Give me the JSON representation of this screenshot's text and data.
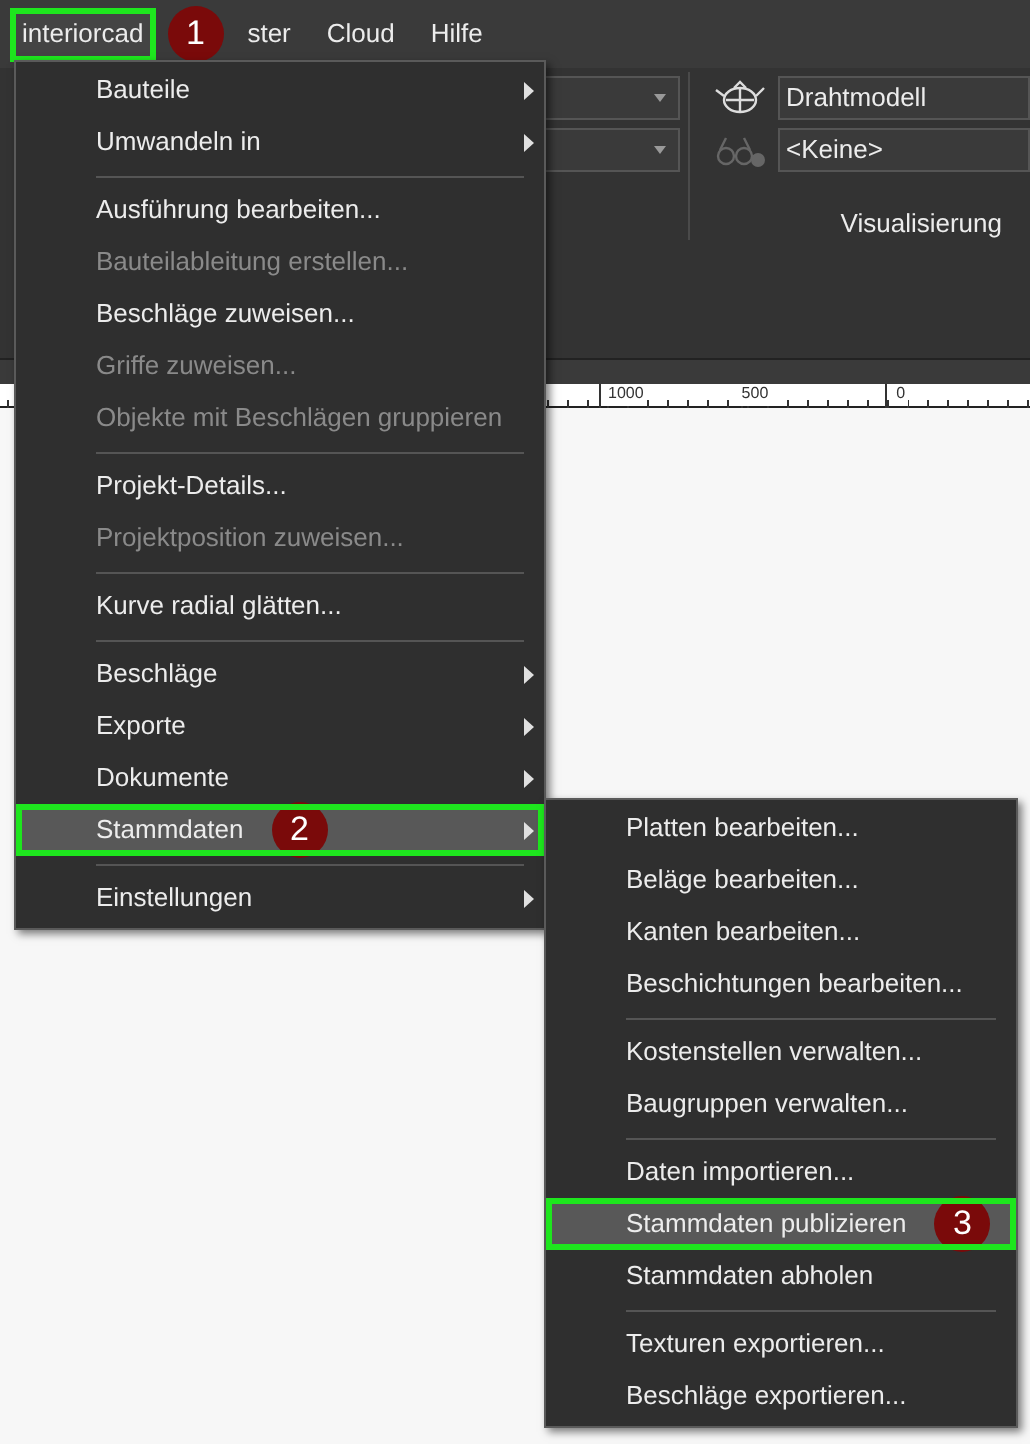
{
  "menubar": [
    {
      "label": "interiorcad",
      "selected": true,
      "callout": "1"
    },
    {
      "label": "ster",
      "selected": false
    },
    {
      "label": "Cloud",
      "selected": false
    },
    {
      "label": "Hilfe",
      "selected": false
    }
  ],
  "ribbon": {
    "display_mode": "Drahtmodell",
    "glasses": "<Keine>",
    "group_label": "Visualisierung"
  },
  "ruler": {
    "labels": [
      "1000",
      "500",
      "0"
    ]
  },
  "menu": [
    {
      "kind": "item",
      "label": "Bauteile",
      "disabled": false,
      "submenu": true,
      "selected": false
    },
    {
      "kind": "item",
      "label": "Umwandeln in",
      "disabled": false,
      "submenu": true,
      "selected": false
    },
    {
      "kind": "separator"
    },
    {
      "kind": "item",
      "label": "Ausführung bearbeiten...",
      "disabled": false,
      "submenu": false,
      "selected": false
    },
    {
      "kind": "item",
      "label": "Bauteilableitung erstellen...",
      "disabled": true,
      "submenu": false,
      "selected": false
    },
    {
      "kind": "item",
      "label": "Beschläge zuweisen...",
      "disabled": false,
      "submenu": false,
      "selected": false
    },
    {
      "kind": "item",
      "label": "Griffe zuweisen...",
      "disabled": true,
      "submenu": false,
      "selected": false
    },
    {
      "kind": "item",
      "label": "Objekte mit Beschlägen gruppieren",
      "disabled": true,
      "submenu": false,
      "selected": false
    },
    {
      "kind": "separator"
    },
    {
      "kind": "item",
      "label": "Projekt-Details...",
      "disabled": false,
      "submenu": false,
      "selected": false
    },
    {
      "kind": "item",
      "label": "Projektposition zuweisen...",
      "disabled": true,
      "submenu": false,
      "selected": false
    },
    {
      "kind": "separator"
    },
    {
      "kind": "item",
      "label": "Kurve radial glätten...",
      "disabled": false,
      "submenu": false,
      "selected": false
    },
    {
      "kind": "separator"
    },
    {
      "kind": "item",
      "label": "Beschläge",
      "disabled": false,
      "submenu": true,
      "selected": false
    },
    {
      "kind": "item",
      "label": "Exporte",
      "disabled": false,
      "submenu": true,
      "selected": false
    },
    {
      "kind": "item",
      "label": "Dokumente",
      "disabled": false,
      "submenu": true,
      "selected": false
    },
    {
      "kind": "item",
      "label": "Stammdaten",
      "disabled": false,
      "submenu": true,
      "selected": true,
      "callout": "2"
    },
    {
      "kind": "separator"
    },
    {
      "kind": "item",
      "label": "Einstellungen",
      "disabled": false,
      "submenu": true,
      "selected": false
    }
  ],
  "submenu": [
    {
      "kind": "item",
      "label": "Platten bearbeiten...",
      "selected": false
    },
    {
      "kind": "item",
      "label": "Beläge bearbeiten...",
      "selected": false
    },
    {
      "kind": "item",
      "label": "Kanten bearbeiten...",
      "selected": false
    },
    {
      "kind": "item",
      "label": "Beschichtungen bearbeiten...",
      "selected": false
    },
    {
      "kind": "separator"
    },
    {
      "kind": "item",
      "label": "Kostenstellen verwalten...",
      "selected": false
    },
    {
      "kind": "item",
      "label": "Baugruppen verwalten...",
      "selected": false
    },
    {
      "kind": "separator"
    },
    {
      "kind": "item",
      "label": "Daten importieren...",
      "selected": false
    },
    {
      "kind": "item",
      "label": "Stammdaten publizieren",
      "selected": true,
      "callout": "3"
    },
    {
      "kind": "item",
      "label": "Stammdaten abholen",
      "selected": false
    },
    {
      "kind": "separator"
    },
    {
      "kind": "item",
      "label": "Texturen exportieren...",
      "selected": false
    },
    {
      "kind": "item",
      "label": "Beschläge exportieren...",
      "selected": false
    }
  ]
}
